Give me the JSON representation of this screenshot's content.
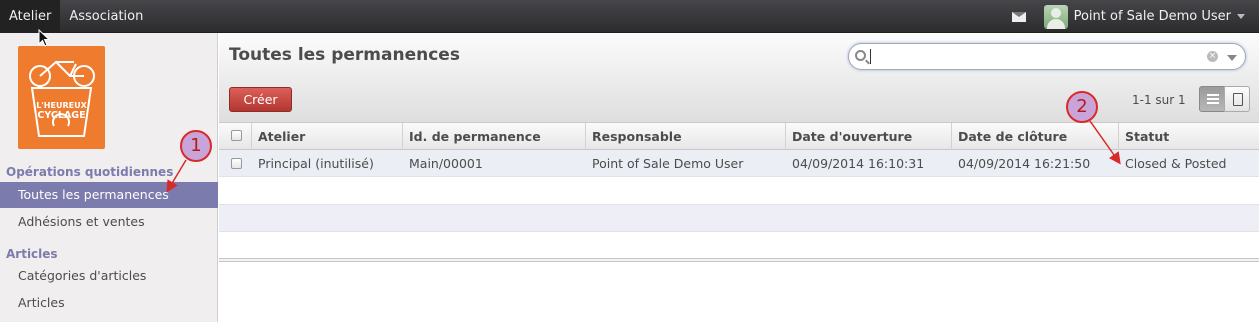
{
  "topbar": {
    "menu": [
      "Atelier",
      "Association"
    ],
    "user_name": "Point of Sale Demo User",
    "mail_icon": "envelope-icon"
  },
  "sidebar": {
    "logo_lines": [
      "L'HEUREUX",
      "CYCLAGE"
    ],
    "sections": [
      {
        "title": "Opérations quotidiennes",
        "items": [
          "Toutes les permanences",
          "Adhésions et ventes"
        ]
      },
      {
        "title": "Articles",
        "items": [
          "Catégories d'articles",
          "Articles"
        ]
      }
    ],
    "active_item": "Toutes les permanences"
  },
  "main": {
    "title": "Toutes les permanences",
    "search": {
      "value": "",
      "placeholder": ""
    },
    "create_label": "Créer",
    "pager": "1-1 sur 1",
    "active_view": "list"
  },
  "table": {
    "columns": [
      "Atelier",
      "Id. de permanence",
      "Responsable",
      "Date d'ouverture",
      "Date de clôture",
      "Statut"
    ],
    "rows": [
      [
        "Principal (inutilisé)",
        "Main/00001",
        "Point of Sale Demo User",
        "04/09/2014 16:10:31",
        "04/09/2014 16:21:50",
        "Closed & Posted"
      ]
    ]
  },
  "annotations": [
    "1",
    "2"
  ],
  "colors": {
    "accent": "#7c7bad",
    "create_button": "#c4403a",
    "logo": "#ef7c2e",
    "annotation_border": "#d82a2a"
  }
}
